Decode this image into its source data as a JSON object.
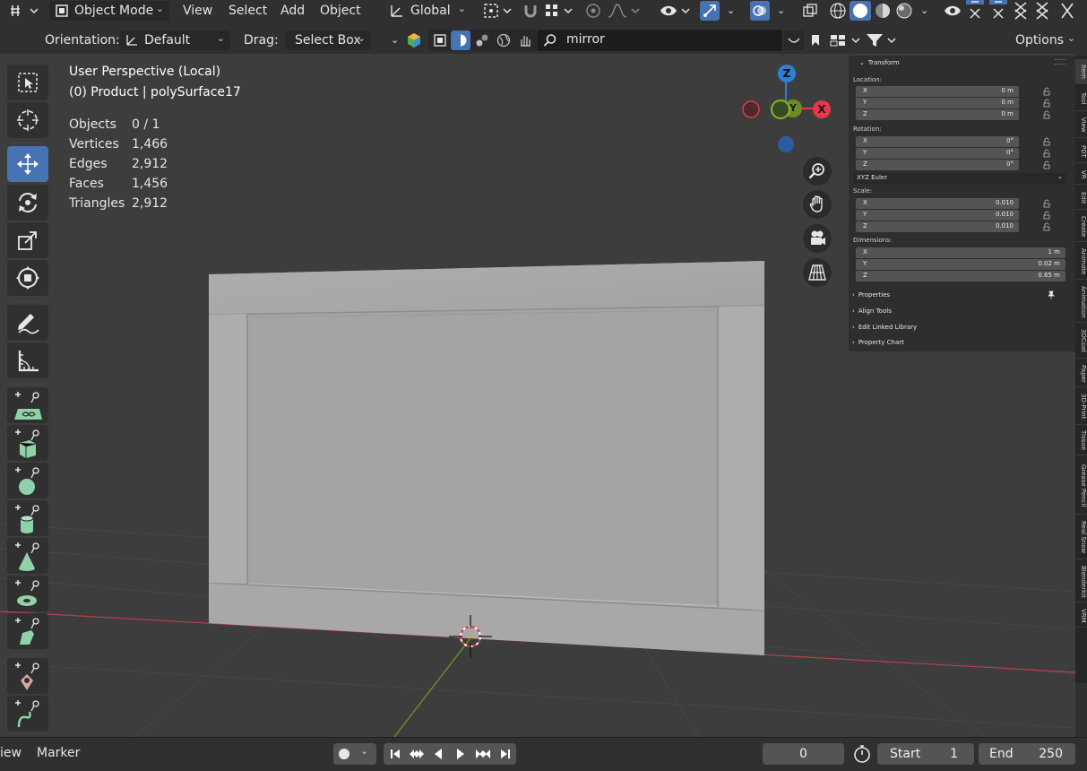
{
  "header": {
    "mode": "Object Mode",
    "menus": [
      "View",
      "Select",
      "Add",
      "Object"
    ],
    "transform_orientation": "Global"
  },
  "tool_header": {
    "orientation_label": "Orientation:",
    "orientation_value": "Default",
    "drag_label": "Drag:",
    "drag_value": "Select Box",
    "search_text": "mirror",
    "options_label": "Options"
  },
  "overlay": {
    "view_name": "User Perspective (Local)",
    "object_info": "(0) Product | polySurface17",
    "stats": [
      {
        "label": "Objects",
        "value": "0 / 1"
      },
      {
        "label": "Vertices",
        "value": "1,466"
      },
      {
        "label": "Edges",
        "value": "2,912"
      },
      {
        "label": "Faces",
        "value": "1,456"
      },
      {
        "label": "Triangles",
        "value": "2,912"
      }
    ]
  },
  "gizmo": {
    "z_label": "Z",
    "y_label": "Y",
    "x_label": "X",
    "colors": {
      "x": "#e8374d",
      "y": "#80b828",
      "z": "#2e7ed6"
    }
  },
  "sidebar": {
    "transform_title": "Transform",
    "location_label": "Location:",
    "location": [
      {
        "axis": "X",
        "value": "0 m"
      },
      {
        "axis": "Y",
        "value": "0 m"
      },
      {
        "axis": "Z",
        "value": "0 m"
      }
    ],
    "rotation_label": "Rotation:",
    "rotation": [
      {
        "axis": "X",
        "value": "0°"
      },
      {
        "axis": "Y",
        "value": "0°"
      },
      {
        "axis": "Z",
        "value": "0°"
      }
    ],
    "rotation_mode": "XYZ Euler",
    "scale_label": "Scale:",
    "scale": [
      {
        "axis": "X",
        "value": "0.010"
      },
      {
        "axis": "Y",
        "value": "0.010"
      },
      {
        "axis": "Z",
        "value": "0.010"
      }
    ],
    "dimensions_label": "Dimensions:",
    "dimensions": [
      {
        "axis": "X",
        "value": "1 m"
      },
      {
        "axis": "Y",
        "value": "0.02 m"
      },
      {
        "axis": "Z",
        "value": "0.65 m"
      }
    ],
    "panels": [
      "Properties",
      "Align Tools",
      "Edit Linked Library",
      "Property Chart"
    ],
    "tabs": [
      "Item",
      "Tool",
      "View",
      "PDT",
      "VR",
      "Edit",
      "Create",
      "Animate",
      "Animation",
      "3DCoat",
      "Paper",
      "3D-Print",
      "Tissue",
      "Grease Pencil",
      "Real Snow",
      "Blenderkit",
      "VRM"
    ]
  },
  "timeline": {
    "view_label": "iew",
    "marker_label": "Marker",
    "current_frame": "0",
    "start_label": "Start",
    "start_value": "1",
    "end_label": "End",
    "end_value": "250"
  },
  "theme": {
    "accent": "#4772b3",
    "axis_x": "#b8414b",
    "axis_y": "#6b8e23"
  }
}
